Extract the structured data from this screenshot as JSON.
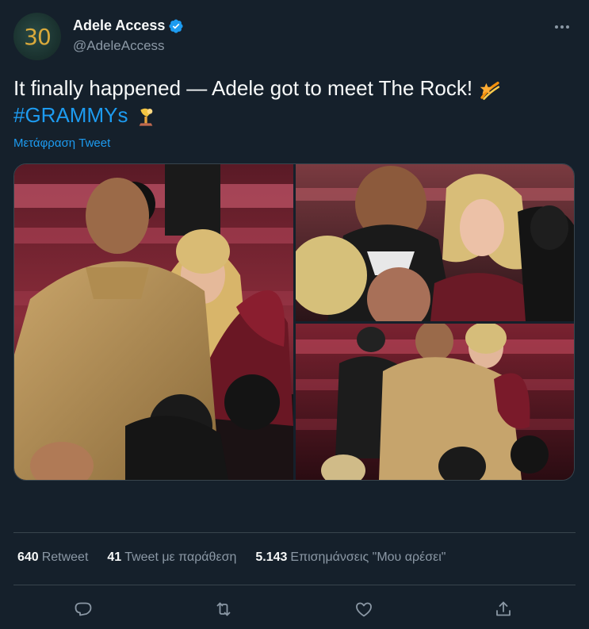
{
  "author": {
    "avatar_text": "30",
    "display_name": "Adele Access",
    "handle": "@AdeleAccess",
    "verified": true
  },
  "tweet": {
    "text_main": "It finally happened — Adele got to meet The Rock! ",
    "hashtag": "#GRAMMYs",
    "emoji_1": "shooting-star-emoji",
    "emoji_2": "grammy-trophy-emoji",
    "translate_label": "Μετάφραση Tweet"
  },
  "media": {
    "photos": [
      "photo-1",
      "photo-2",
      "photo-3"
    ]
  },
  "stats": {
    "retweets_count": "640",
    "retweets_label": "Retweet",
    "quotes_count": "41",
    "quotes_label": "Tweet με παράθεση",
    "likes_count": "5.143",
    "likes_label": "Επισημάνσεις \"Μου αρέσει\""
  },
  "icons": {
    "reply": "reply-icon",
    "retweet": "retweet-icon",
    "like": "like-icon",
    "share": "share-icon"
  },
  "colors": {
    "background": "#15202b",
    "accent": "#1d9bf0",
    "secondary_text": "#8b98a5",
    "border": "#38444d"
  }
}
